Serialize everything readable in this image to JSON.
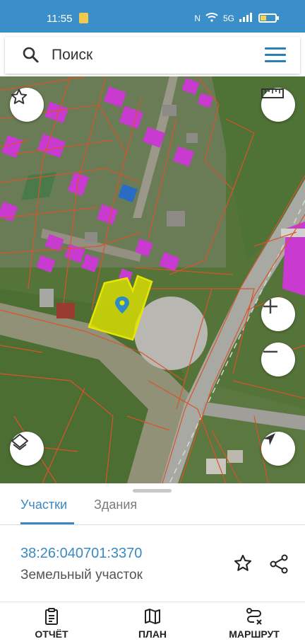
{
  "status_bar": {
    "time": "11:55",
    "network": "5G"
  },
  "search": {
    "placeholder": "Поиск"
  },
  "tabs": [
    {
      "label": "Участки",
      "active": true
    },
    {
      "label": "Здания",
      "active": false
    }
  ],
  "parcel": {
    "cadastral_number": "38:26:040701:3370",
    "type": "Земельный участок"
  },
  "bottom_nav": [
    {
      "label": "ОТЧЁТ",
      "icon": "report-icon"
    },
    {
      "label": "ПЛАН",
      "icon": "map-plan-icon"
    },
    {
      "label": "МАРШРУТ",
      "icon": "route-icon"
    }
  ],
  "colors": {
    "accent": "#3a89c2",
    "status_bar": "#3b8fc8",
    "selected_parcel": "#e2e600",
    "buildings": "#c83ad0",
    "boundaries": "#d8542a"
  }
}
